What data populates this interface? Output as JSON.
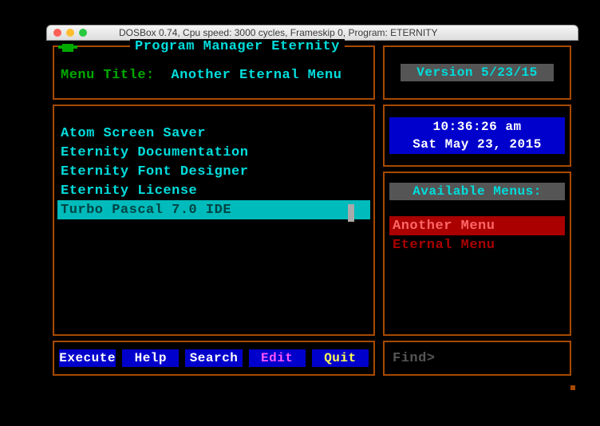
{
  "window": {
    "title": "DOSBox 0.74, Cpu speed:    3000 cycles, Frameskip  0, Program: ETERNITY"
  },
  "header": {
    "app_title": "Program Manager Eternity",
    "menu_title_label": "Menu Title:",
    "menu_title_value": "Another Eternal Menu"
  },
  "version": {
    "text": "Version 5/23/15"
  },
  "list": {
    "items": [
      "Atom Screen Saver",
      "Eternity Documentation",
      "Eternity Font Designer",
      "Eternity License",
      "Turbo Pascal 7.0 IDE"
    ],
    "selected_index": 4
  },
  "clock": {
    "time": "10:36:26 am",
    "date": "Sat May 23, 2015"
  },
  "available": {
    "header": "Available Menus:",
    "items": [
      "Another Menu",
      "Eternal Menu"
    ],
    "selected_index": 0
  },
  "buttons": {
    "execute": "Execute",
    "help": "Help",
    "search": "Search",
    "edit": "Edit",
    "quit": "Quit"
  },
  "find": {
    "label": "Find>"
  }
}
